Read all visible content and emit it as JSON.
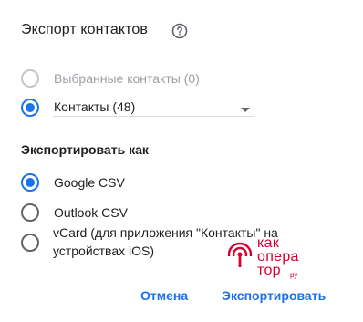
{
  "dialog": {
    "title": "Экспорт контактов",
    "help_icon": "help-circle-icon"
  },
  "contacts_selection": {
    "options": [
      {
        "label": "Выбранные контакты (0)",
        "checked": false,
        "disabled": true
      },
      {
        "label": "Контакты (48)",
        "checked": true,
        "disabled": false
      }
    ],
    "dropdown_icon": "caret-down-icon"
  },
  "export_format": {
    "section_title": "Экспортировать как",
    "options": [
      {
        "label": "Google CSV",
        "checked": true
      },
      {
        "label": "Outlook CSV",
        "checked": false
      },
      {
        "label": "vCard (для приложения \"Контакты\" на устройствах iOS)",
        "checked": false
      }
    ]
  },
  "actions": {
    "cancel_label": "Отмена",
    "export_label": "Экспортировать"
  },
  "watermark": {
    "line1": "как",
    "line2": "опера",
    "line3": "тор",
    "suffix": "ру"
  },
  "colors": {
    "accent": "#1a73e8",
    "text": "#202124",
    "disabled": "#9aa0a6",
    "watermark": "#d50032"
  }
}
